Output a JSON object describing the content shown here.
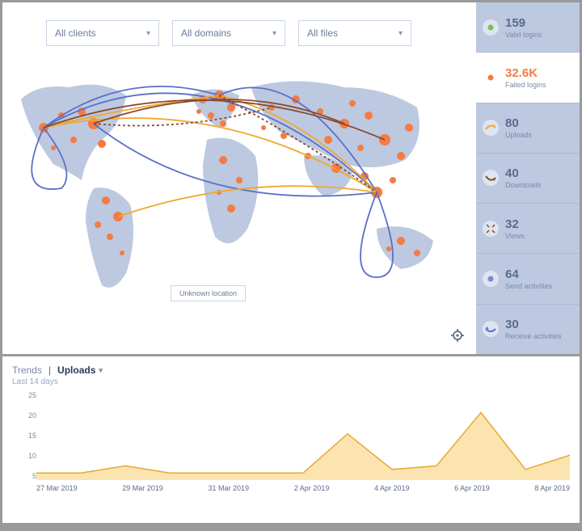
{
  "filters": {
    "clients": "All clients",
    "domains": "All domains",
    "files": "All files"
  },
  "map": {
    "unknown_location_label": "Unknown location"
  },
  "stats": [
    {
      "value": "159",
      "label": "Valid logins",
      "icon": "dot",
      "icon_color": "#7abf5a",
      "active": false
    },
    {
      "value": "32.6K",
      "label": "Failed logins",
      "icon": "dot",
      "icon_color": "#f57b42",
      "active": true
    },
    {
      "value": "80",
      "label": "Uploads",
      "icon": "arrow-up",
      "icon_color": "#f0a830",
      "active": false
    },
    {
      "value": "40",
      "label": "Downloads",
      "icon": "arrow-down",
      "icon_color": "#8a4a2e",
      "active": false
    },
    {
      "value": "32",
      "label": "Views",
      "icon": "expand",
      "icon_color": "#8a4a2e",
      "active": false
    },
    {
      "value": "64",
      "label": "Send activities",
      "icon": "dot",
      "icon_color": "#7a8acc",
      "active": false
    },
    {
      "value": "30",
      "label": "Receive activities",
      "icon": "receive",
      "icon_color": "#5b6fc9",
      "active": false
    }
  ],
  "trends": {
    "label": "Trends",
    "selected": "Uploads",
    "subtitle": "Last 14 days"
  },
  "chart_data": {
    "type": "area",
    "title": "Uploads",
    "xlabel": "",
    "ylabel": "",
    "ylim": [
      0,
      25
    ],
    "y_ticks": [
      25,
      20,
      15,
      10,
      5
    ],
    "x_ticks": [
      "27 Mar 2019",
      "29 Mar 2019",
      "31 Mar 2019",
      "2 Apr 2019",
      "4 Apr 2019",
      "6 Apr 2019",
      "8 Apr 2019"
    ],
    "x": [
      "27 Mar 2019",
      "28 Mar 2019",
      "29 Mar 2019",
      "30 Mar 2019",
      "31 Mar 2019",
      "1 Apr 2019",
      "2 Apr 2019",
      "3 Apr 2019",
      "4 Apr 2019",
      "5 Apr 2019",
      "6 Apr 2019",
      "7 Apr 2019",
      "8 Apr 2019"
    ],
    "values": [
      2,
      2,
      4,
      2,
      2,
      2,
      2,
      13,
      3,
      4,
      19,
      3,
      7
    ],
    "color": "#f0b040"
  }
}
